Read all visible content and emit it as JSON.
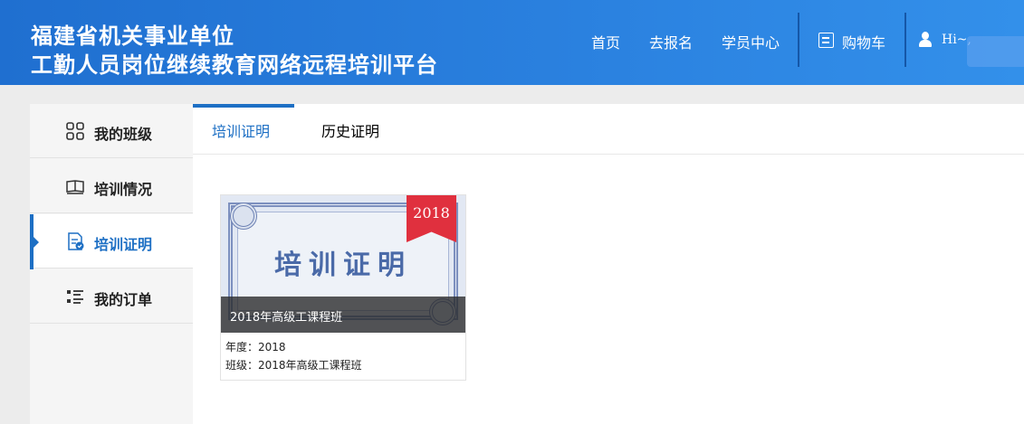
{
  "header": {
    "title_line1": "福建省机关事业单位",
    "title_line2": "工勤人员岗位继续教育网络远程培训平台",
    "nav": {
      "home": "首页",
      "register": "去报名",
      "student_center": "学员中心",
      "cart": "购物车"
    },
    "user_greeting": "Hi~,",
    "bg_color": "#2b82e0"
  },
  "sidebar": {
    "items": [
      {
        "label": "我的班级",
        "icon": "grid-icon"
      },
      {
        "label": "培训情况",
        "icon": "book-icon"
      },
      {
        "label": "培训证明",
        "icon": "certificate-icon"
      },
      {
        "label": "我的订单",
        "icon": "list-icon"
      }
    ],
    "active_index": 2,
    "accent_color": "#1d6fc4"
  },
  "tabs": [
    {
      "label": "培训证明"
    },
    {
      "label": "历史证明"
    }
  ],
  "certificates": [
    {
      "image_title": "培训证明",
      "ribbon_year": "2018",
      "bar_text": "2018年高级工课程班",
      "year_line": "年度：2018",
      "class_line": "班级：2018年高级工课程班",
      "ribbon_color": "#e0303e"
    }
  ]
}
